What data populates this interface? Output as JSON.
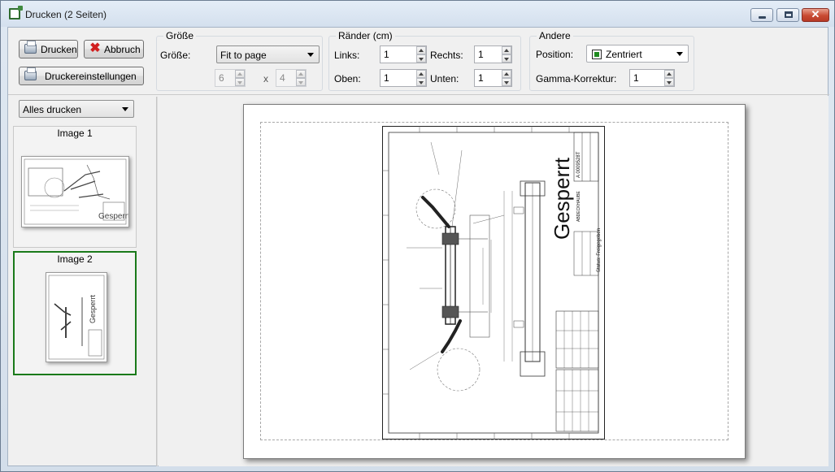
{
  "window": {
    "title": "Drucken (2 Seiten)"
  },
  "toolbar": {
    "print_label": "Drucken",
    "cancel_label": "Abbruch",
    "printer_settings_label": "Druckereinstellungen"
  },
  "size_group": {
    "label": "Größe",
    "size_label": "Größe:",
    "size_value": "Fit to page",
    "width_value": "6",
    "height_value": "4",
    "times": "x"
  },
  "margins_group": {
    "label": "Ränder (cm)",
    "left_label": "Links:",
    "left_value": "1",
    "right_label": "Rechts:",
    "right_value": "1",
    "top_label": "Oben:",
    "top_value": "1",
    "bottom_label": "Unten:",
    "bottom_value": "1"
  },
  "other_group": {
    "label": "Andere",
    "position_label": "Position:",
    "position_value": "Zentriert",
    "gamma_label": "Gamma-Korrektur:",
    "gamma_value": "1"
  },
  "page_select": {
    "value": "Alles drucken"
  },
  "thumbnails": [
    {
      "label": "Image 1",
      "selected": false,
      "watermark": "Gesperrt"
    },
    {
      "label": "Image 2",
      "selected": true,
      "watermark": "Gesperrt"
    }
  ],
  "preview": {
    "watermark": "Gesperrt",
    "drawing_number": "A 0009528T",
    "part_name": "ABDECKHAUBE",
    "status": "Status: Freigegeben"
  },
  "colors": {
    "accent": "#1a7a1a",
    "close": "#c84a32"
  }
}
